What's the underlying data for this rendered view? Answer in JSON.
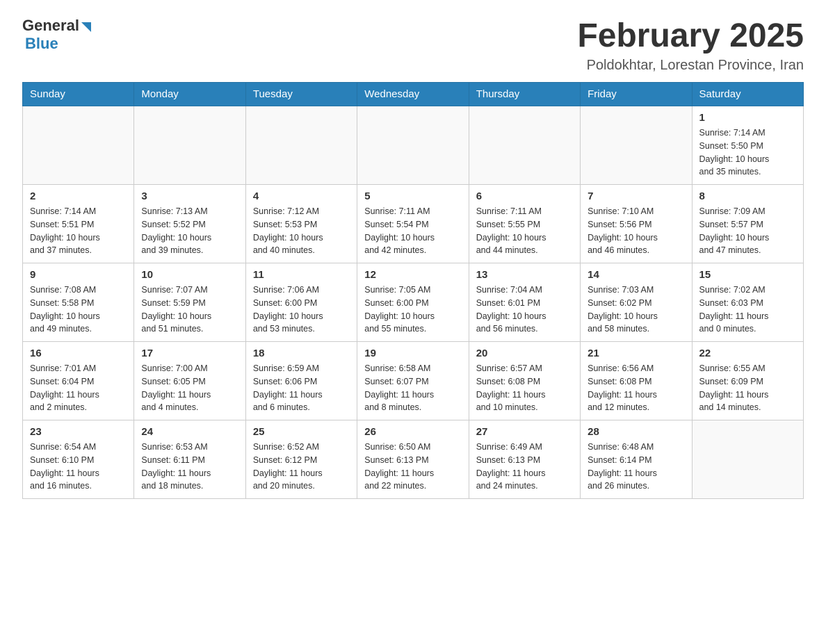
{
  "logo": {
    "general": "General",
    "blue": "Blue"
  },
  "title": "February 2025",
  "location": "Poldokhtar, Lorestan Province, Iran",
  "days_of_week": [
    "Sunday",
    "Monday",
    "Tuesday",
    "Wednesday",
    "Thursday",
    "Friday",
    "Saturday"
  ],
  "weeks": [
    [
      {
        "day": "",
        "info": ""
      },
      {
        "day": "",
        "info": ""
      },
      {
        "day": "",
        "info": ""
      },
      {
        "day": "",
        "info": ""
      },
      {
        "day": "",
        "info": ""
      },
      {
        "day": "",
        "info": ""
      },
      {
        "day": "1",
        "info": "Sunrise: 7:14 AM\nSunset: 5:50 PM\nDaylight: 10 hours\nand 35 minutes."
      }
    ],
    [
      {
        "day": "2",
        "info": "Sunrise: 7:14 AM\nSunset: 5:51 PM\nDaylight: 10 hours\nand 37 minutes."
      },
      {
        "day": "3",
        "info": "Sunrise: 7:13 AM\nSunset: 5:52 PM\nDaylight: 10 hours\nand 39 minutes."
      },
      {
        "day": "4",
        "info": "Sunrise: 7:12 AM\nSunset: 5:53 PM\nDaylight: 10 hours\nand 40 minutes."
      },
      {
        "day": "5",
        "info": "Sunrise: 7:11 AM\nSunset: 5:54 PM\nDaylight: 10 hours\nand 42 minutes."
      },
      {
        "day": "6",
        "info": "Sunrise: 7:11 AM\nSunset: 5:55 PM\nDaylight: 10 hours\nand 44 minutes."
      },
      {
        "day": "7",
        "info": "Sunrise: 7:10 AM\nSunset: 5:56 PM\nDaylight: 10 hours\nand 46 minutes."
      },
      {
        "day": "8",
        "info": "Sunrise: 7:09 AM\nSunset: 5:57 PM\nDaylight: 10 hours\nand 47 minutes."
      }
    ],
    [
      {
        "day": "9",
        "info": "Sunrise: 7:08 AM\nSunset: 5:58 PM\nDaylight: 10 hours\nand 49 minutes."
      },
      {
        "day": "10",
        "info": "Sunrise: 7:07 AM\nSunset: 5:59 PM\nDaylight: 10 hours\nand 51 minutes."
      },
      {
        "day": "11",
        "info": "Sunrise: 7:06 AM\nSunset: 6:00 PM\nDaylight: 10 hours\nand 53 minutes."
      },
      {
        "day": "12",
        "info": "Sunrise: 7:05 AM\nSunset: 6:00 PM\nDaylight: 10 hours\nand 55 minutes."
      },
      {
        "day": "13",
        "info": "Sunrise: 7:04 AM\nSunset: 6:01 PM\nDaylight: 10 hours\nand 56 minutes."
      },
      {
        "day": "14",
        "info": "Sunrise: 7:03 AM\nSunset: 6:02 PM\nDaylight: 10 hours\nand 58 minutes."
      },
      {
        "day": "15",
        "info": "Sunrise: 7:02 AM\nSunset: 6:03 PM\nDaylight: 11 hours\nand 0 minutes."
      }
    ],
    [
      {
        "day": "16",
        "info": "Sunrise: 7:01 AM\nSunset: 6:04 PM\nDaylight: 11 hours\nand 2 minutes."
      },
      {
        "day": "17",
        "info": "Sunrise: 7:00 AM\nSunset: 6:05 PM\nDaylight: 11 hours\nand 4 minutes."
      },
      {
        "day": "18",
        "info": "Sunrise: 6:59 AM\nSunset: 6:06 PM\nDaylight: 11 hours\nand 6 minutes."
      },
      {
        "day": "19",
        "info": "Sunrise: 6:58 AM\nSunset: 6:07 PM\nDaylight: 11 hours\nand 8 minutes."
      },
      {
        "day": "20",
        "info": "Sunrise: 6:57 AM\nSunset: 6:08 PM\nDaylight: 11 hours\nand 10 minutes."
      },
      {
        "day": "21",
        "info": "Sunrise: 6:56 AM\nSunset: 6:08 PM\nDaylight: 11 hours\nand 12 minutes."
      },
      {
        "day": "22",
        "info": "Sunrise: 6:55 AM\nSunset: 6:09 PM\nDaylight: 11 hours\nand 14 minutes."
      }
    ],
    [
      {
        "day": "23",
        "info": "Sunrise: 6:54 AM\nSunset: 6:10 PM\nDaylight: 11 hours\nand 16 minutes."
      },
      {
        "day": "24",
        "info": "Sunrise: 6:53 AM\nSunset: 6:11 PM\nDaylight: 11 hours\nand 18 minutes."
      },
      {
        "day": "25",
        "info": "Sunrise: 6:52 AM\nSunset: 6:12 PM\nDaylight: 11 hours\nand 20 minutes."
      },
      {
        "day": "26",
        "info": "Sunrise: 6:50 AM\nSunset: 6:13 PM\nDaylight: 11 hours\nand 22 minutes."
      },
      {
        "day": "27",
        "info": "Sunrise: 6:49 AM\nSunset: 6:13 PM\nDaylight: 11 hours\nand 24 minutes."
      },
      {
        "day": "28",
        "info": "Sunrise: 6:48 AM\nSunset: 6:14 PM\nDaylight: 11 hours\nand 26 minutes."
      },
      {
        "day": "",
        "info": ""
      }
    ]
  ]
}
